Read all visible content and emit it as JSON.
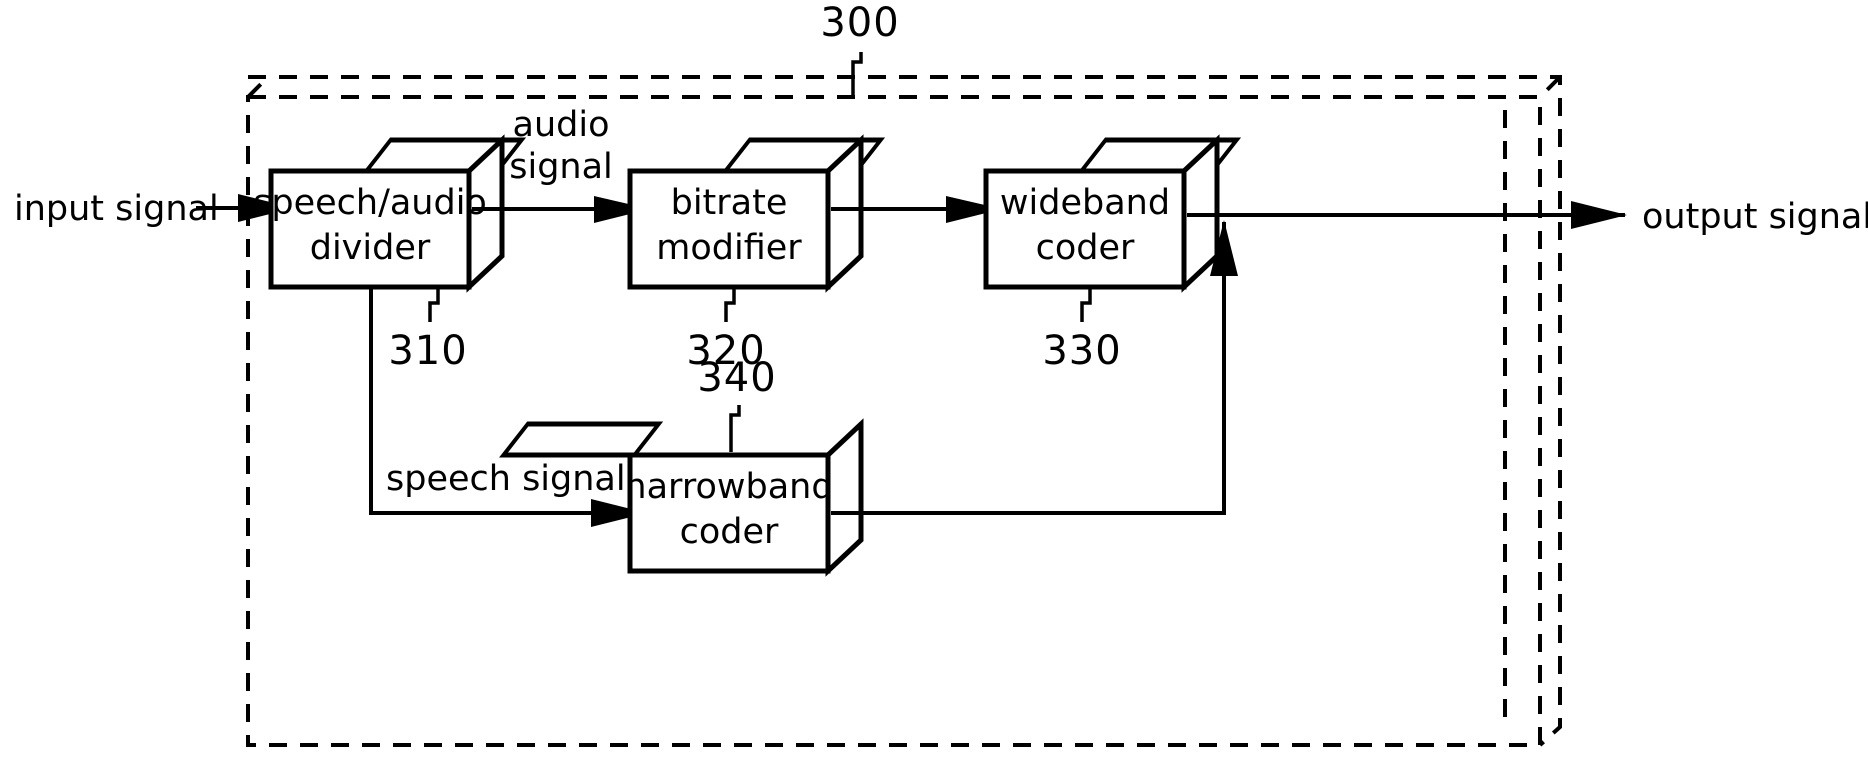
{
  "figure": {
    "container_ref": "300",
    "blocks": [
      {
        "id": "divider",
        "line1": "speech/audio",
        "line2": "divider",
        "ref": "310"
      },
      {
        "id": "bitrate",
        "line1": "bitrate",
        "line2": "modifier",
        "ref": "320"
      },
      {
        "id": "wideband",
        "line1": "wideband",
        "line2": "coder",
        "ref": "330"
      },
      {
        "id": "narrowband",
        "line1": "narrowband",
        "line2": "coder",
        "ref": "340"
      }
    ],
    "signals": {
      "input": "input  signal",
      "output": "output  signal",
      "audio_line1": "audio",
      "audio_line2": "signal",
      "speech": "speech  signal"
    },
    "colors": {
      "ink": "#000000",
      "paper": "#ffffff"
    }
  }
}
